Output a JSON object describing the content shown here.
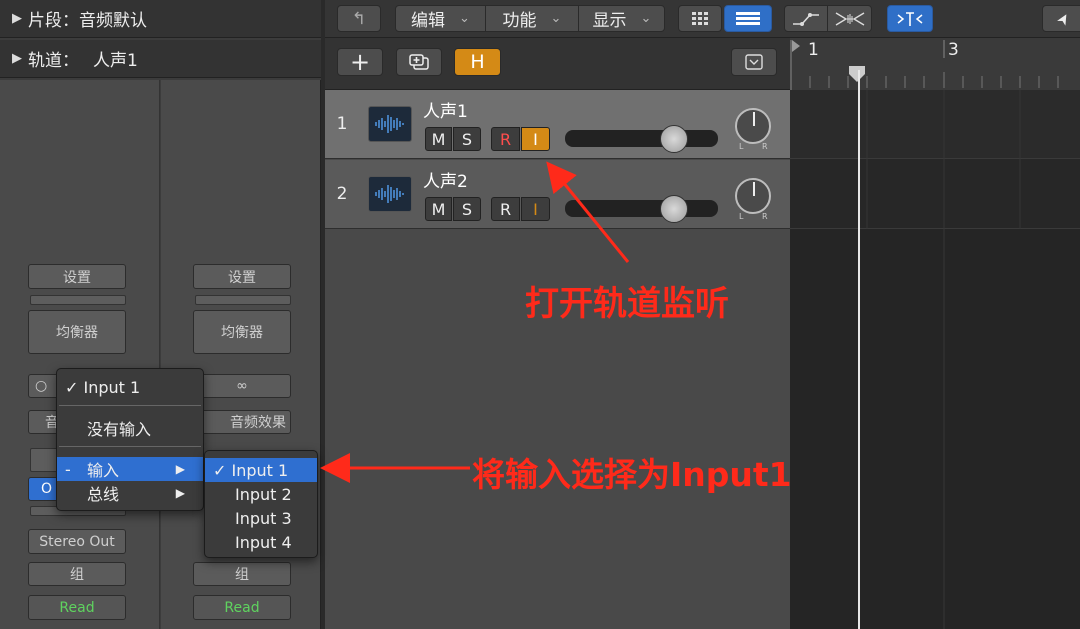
{
  "inspector": {
    "region_label": "片段：音频默认",
    "track_label": "轨道：",
    "track_name": "人声1",
    "strip_left": {
      "setting": "设置",
      "eq": "均衡器",
      "input_icon": "○",
      "audio_fx_partial": "音",
      "output_partial": "O",
      "output": "Stereo Out",
      "group": "组",
      "automation": "Read"
    },
    "strip_right": {
      "setting": "设置",
      "eq": "均衡器",
      "input_icon": "∞",
      "audio_fx": "音频效果",
      "group": "组",
      "automation": "Read"
    }
  },
  "toolbar": {
    "back_icon": "↰",
    "edit": "编辑",
    "function": "功能",
    "view": "显示",
    "chevron": "⌄",
    "pointer_icon": "➤"
  },
  "track_header": {
    "add_icon": "+",
    "hide_label": "H",
    "collapse_icon": "⌄"
  },
  "ruler": {
    "bar1": "1",
    "bar3": "3"
  },
  "tracks": [
    {
      "number": "1",
      "name": "人声1",
      "mute": "M",
      "solo": "S",
      "record": "R",
      "input_monitor": "I",
      "pan_l": "L",
      "pan_r": "R"
    },
    {
      "number": "2",
      "name": "人声2",
      "mute": "M",
      "solo": "S",
      "record": "R",
      "input_monitor": "I",
      "pan_l": "L",
      "pan_r": "R"
    }
  ],
  "input_menu": {
    "checked_item": "✓ Input 1",
    "no_input": "没有输入",
    "input_dash": "-",
    "input": "输入",
    "bus": "总线",
    "arrow": "▶"
  },
  "input_submenu": {
    "items": [
      "✓ Input 1",
      "Input 2",
      "Input 3",
      "Input 4"
    ]
  },
  "annotations": {
    "monitor": "打开轨道监听",
    "select_input": "将输入选择为Input1"
  },
  "colors": {
    "accent": "#2f6fd0",
    "annotation": "#ff2a1a",
    "record_active": "#ff4d4d",
    "monitor_on": "#d48a16",
    "hide_button": "#d48a16",
    "read_text": "#5fd35f"
  }
}
